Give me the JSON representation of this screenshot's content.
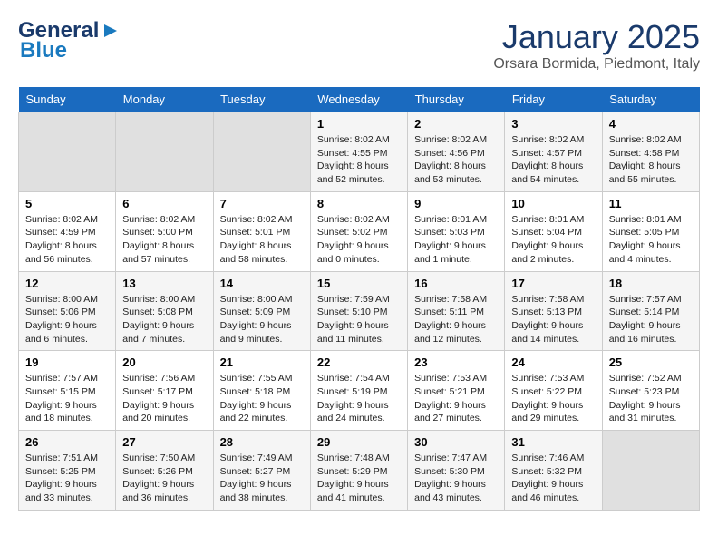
{
  "header": {
    "logo_line1": "General",
    "logo_line2": "Blue",
    "month": "January 2025",
    "location": "Orsara Bormida, Piedmont, Italy"
  },
  "weekdays": [
    "Sunday",
    "Monday",
    "Tuesday",
    "Wednesday",
    "Thursday",
    "Friday",
    "Saturday"
  ],
  "weeks": [
    [
      {
        "day": "",
        "empty": true
      },
      {
        "day": "",
        "empty": true
      },
      {
        "day": "",
        "empty": true
      },
      {
        "day": "1",
        "sunrise": "8:02 AM",
        "sunset": "4:55 PM",
        "daylight": "Daylight: 8 hours and 52 minutes."
      },
      {
        "day": "2",
        "sunrise": "8:02 AM",
        "sunset": "4:56 PM",
        "daylight": "Daylight: 8 hours and 53 minutes."
      },
      {
        "day": "3",
        "sunrise": "8:02 AM",
        "sunset": "4:57 PM",
        "daylight": "Daylight: 8 hours and 54 minutes."
      },
      {
        "day": "4",
        "sunrise": "8:02 AM",
        "sunset": "4:58 PM",
        "daylight": "Daylight: 8 hours and 55 minutes."
      }
    ],
    [
      {
        "day": "5",
        "sunrise": "8:02 AM",
        "sunset": "4:59 PM",
        "daylight": "Daylight: 8 hours and 56 minutes."
      },
      {
        "day": "6",
        "sunrise": "8:02 AM",
        "sunset": "5:00 PM",
        "daylight": "Daylight: 8 hours and 57 minutes."
      },
      {
        "day": "7",
        "sunrise": "8:02 AM",
        "sunset": "5:01 PM",
        "daylight": "Daylight: 8 hours and 58 minutes."
      },
      {
        "day": "8",
        "sunrise": "8:02 AM",
        "sunset": "5:02 PM",
        "daylight": "Daylight: 9 hours and 0 minutes."
      },
      {
        "day": "9",
        "sunrise": "8:01 AM",
        "sunset": "5:03 PM",
        "daylight": "Daylight: 9 hours and 1 minute."
      },
      {
        "day": "10",
        "sunrise": "8:01 AM",
        "sunset": "5:04 PM",
        "daylight": "Daylight: 9 hours and 2 minutes."
      },
      {
        "day": "11",
        "sunrise": "8:01 AM",
        "sunset": "5:05 PM",
        "daylight": "Daylight: 9 hours and 4 minutes."
      }
    ],
    [
      {
        "day": "12",
        "sunrise": "8:00 AM",
        "sunset": "5:06 PM",
        "daylight": "Daylight: 9 hours and 6 minutes."
      },
      {
        "day": "13",
        "sunrise": "8:00 AM",
        "sunset": "5:08 PM",
        "daylight": "Daylight: 9 hours and 7 minutes."
      },
      {
        "day": "14",
        "sunrise": "8:00 AM",
        "sunset": "5:09 PM",
        "daylight": "Daylight: 9 hours and 9 minutes."
      },
      {
        "day": "15",
        "sunrise": "7:59 AM",
        "sunset": "5:10 PM",
        "daylight": "Daylight: 9 hours and 11 minutes."
      },
      {
        "day": "16",
        "sunrise": "7:58 AM",
        "sunset": "5:11 PM",
        "daylight": "Daylight: 9 hours and 12 minutes."
      },
      {
        "day": "17",
        "sunrise": "7:58 AM",
        "sunset": "5:13 PM",
        "daylight": "Daylight: 9 hours and 14 minutes."
      },
      {
        "day": "18",
        "sunrise": "7:57 AM",
        "sunset": "5:14 PM",
        "daylight": "Daylight: 9 hours and 16 minutes."
      }
    ],
    [
      {
        "day": "19",
        "sunrise": "7:57 AM",
        "sunset": "5:15 PM",
        "daylight": "Daylight: 9 hours and 18 minutes."
      },
      {
        "day": "20",
        "sunrise": "7:56 AM",
        "sunset": "5:17 PM",
        "daylight": "Daylight: 9 hours and 20 minutes."
      },
      {
        "day": "21",
        "sunrise": "7:55 AM",
        "sunset": "5:18 PM",
        "daylight": "Daylight: 9 hours and 22 minutes."
      },
      {
        "day": "22",
        "sunrise": "7:54 AM",
        "sunset": "5:19 PM",
        "daylight": "Daylight: 9 hours and 24 minutes."
      },
      {
        "day": "23",
        "sunrise": "7:53 AM",
        "sunset": "5:21 PM",
        "daylight": "Daylight: 9 hours and 27 minutes."
      },
      {
        "day": "24",
        "sunrise": "7:53 AM",
        "sunset": "5:22 PM",
        "daylight": "Daylight: 9 hours and 29 minutes."
      },
      {
        "day": "25",
        "sunrise": "7:52 AM",
        "sunset": "5:23 PM",
        "daylight": "Daylight: 9 hours and 31 minutes."
      }
    ],
    [
      {
        "day": "26",
        "sunrise": "7:51 AM",
        "sunset": "5:25 PM",
        "daylight": "Daylight: 9 hours and 33 minutes."
      },
      {
        "day": "27",
        "sunrise": "7:50 AM",
        "sunset": "5:26 PM",
        "daylight": "Daylight: 9 hours and 36 minutes."
      },
      {
        "day": "28",
        "sunrise": "7:49 AM",
        "sunset": "5:27 PM",
        "daylight": "Daylight: 9 hours and 38 minutes."
      },
      {
        "day": "29",
        "sunrise": "7:48 AM",
        "sunset": "5:29 PM",
        "daylight": "Daylight: 9 hours and 41 minutes."
      },
      {
        "day": "30",
        "sunrise": "7:47 AM",
        "sunset": "5:30 PM",
        "daylight": "Daylight: 9 hours and 43 minutes."
      },
      {
        "day": "31",
        "sunrise": "7:46 AM",
        "sunset": "5:32 PM",
        "daylight": "Daylight: 9 hours and 46 minutes."
      },
      {
        "day": "",
        "empty": true
      }
    ]
  ]
}
